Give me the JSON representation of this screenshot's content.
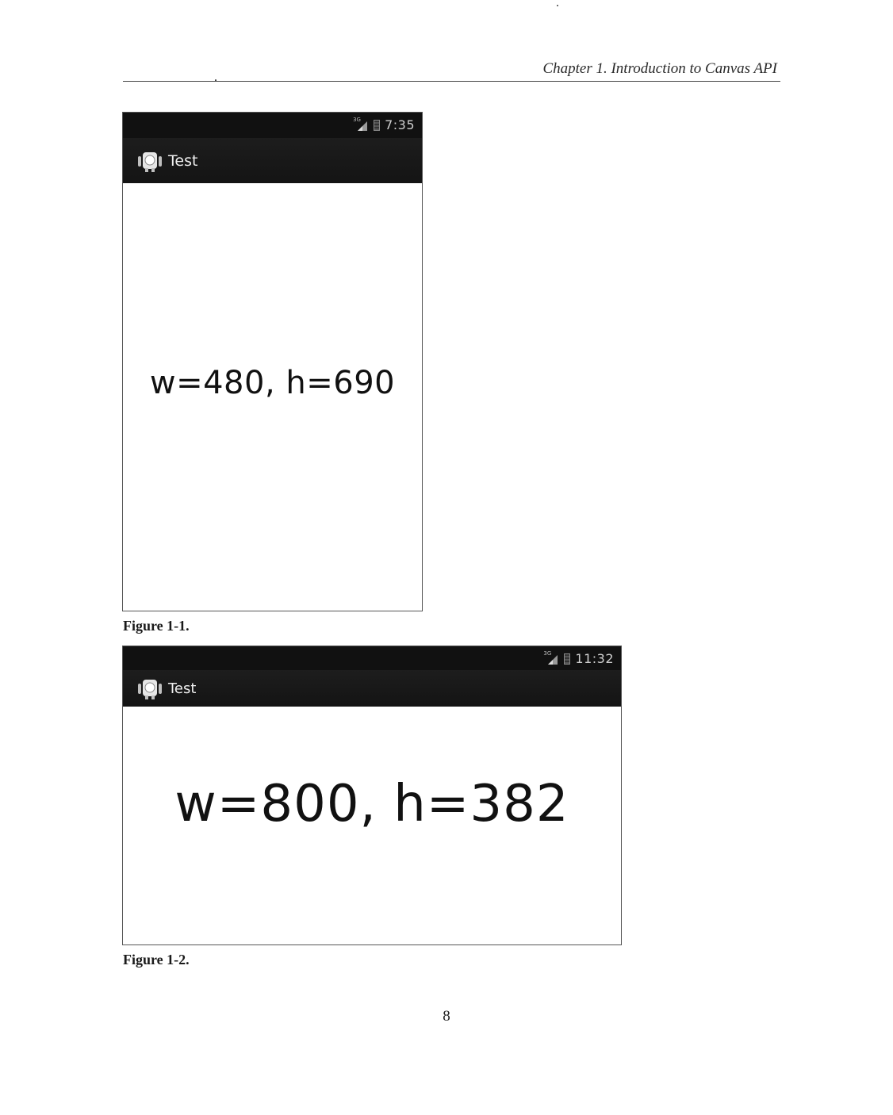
{
  "running_head": "Chapter 1.  Introduction to Canvas API",
  "figures": [
    {
      "status_time": "7:35",
      "network_label": "3G",
      "app_title": "Test",
      "canvas_text": "w=480, h=690",
      "caption": "Figure 1-1."
    },
    {
      "status_time": "11:32",
      "network_label": "3G",
      "app_title": "Test",
      "canvas_text": "w=800, h=382",
      "caption": "Figure 1-2."
    }
  ],
  "page_number": "8",
  "icons": {
    "app_icon": "android-robot-icon",
    "signal": "signal-strength-icon",
    "battery": "battery-icon"
  }
}
